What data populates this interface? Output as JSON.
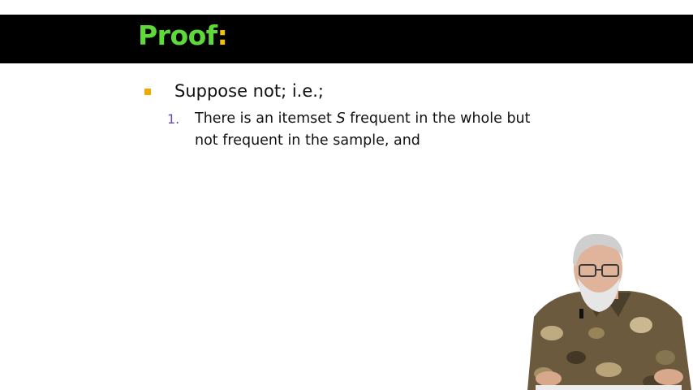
{
  "slide": {
    "title_word": "Proof",
    "title_colon": ":",
    "bullet": "Suppose not; i.e.;",
    "sub_item": {
      "number": "1.",
      "line1_before": "There is an itemset ",
      "line1_var": "S",
      "line1_after": " frequent in the whole but",
      "line2": "not frequent in the sample, and"
    }
  },
  "colors": {
    "title_bar": "#000000",
    "title_text": "#5fd93a",
    "title_colon": "#f2c200",
    "bullet_square": "#f2a900",
    "sub_number": "#6a4aa8"
  },
  "presenter": {
    "icon": "presenter-video-inset"
  }
}
